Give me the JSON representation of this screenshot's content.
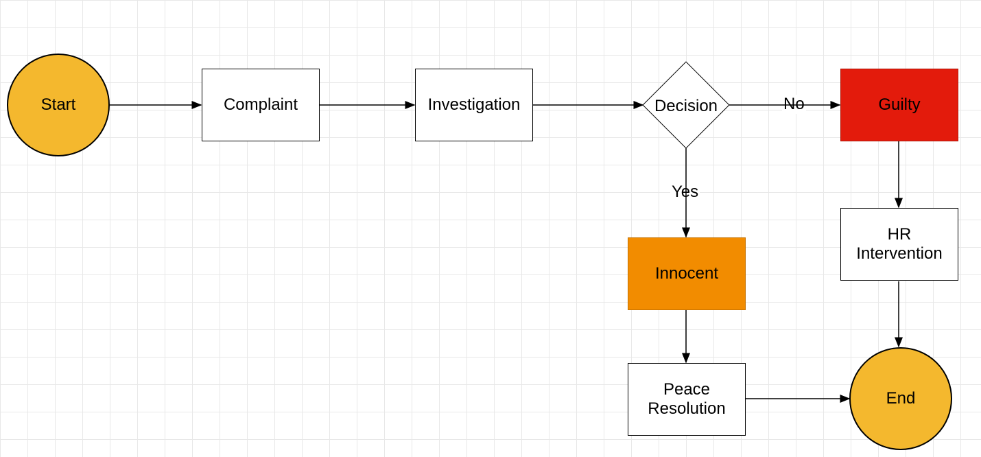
{
  "nodes": {
    "start": {
      "label": "Start",
      "fill": "#f4b82e"
    },
    "complaint": {
      "label": "Complaint",
      "fill": "#ffffff"
    },
    "investigation": {
      "label": "Investigation",
      "fill": "#ffffff"
    },
    "decision": {
      "label": "Decision",
      "fill": "#ffffff"
    },
    "guilty": {
      "label": "Guilty",
      "fill": "#e31b0c"
    },
    "innocent": {
      "label": "Innocent",
      "fill": "#f28c00"
    },
    "hr_intervention": {
      "label": "HR Intervention",
      "fill": "#ffffff"
    },
    "peace_resolution": {
      "label": "Peace Resolution",
      "fill": "#ffffff"
    },
    "end": {
      "label": "End",
      "fill": "#f4b82e"
    }
  },
  "edges": {
    "decision_no": {
      "label": "No"
    },
    "decision_yes": {
      "label": "Yes"
    }
  }
}
